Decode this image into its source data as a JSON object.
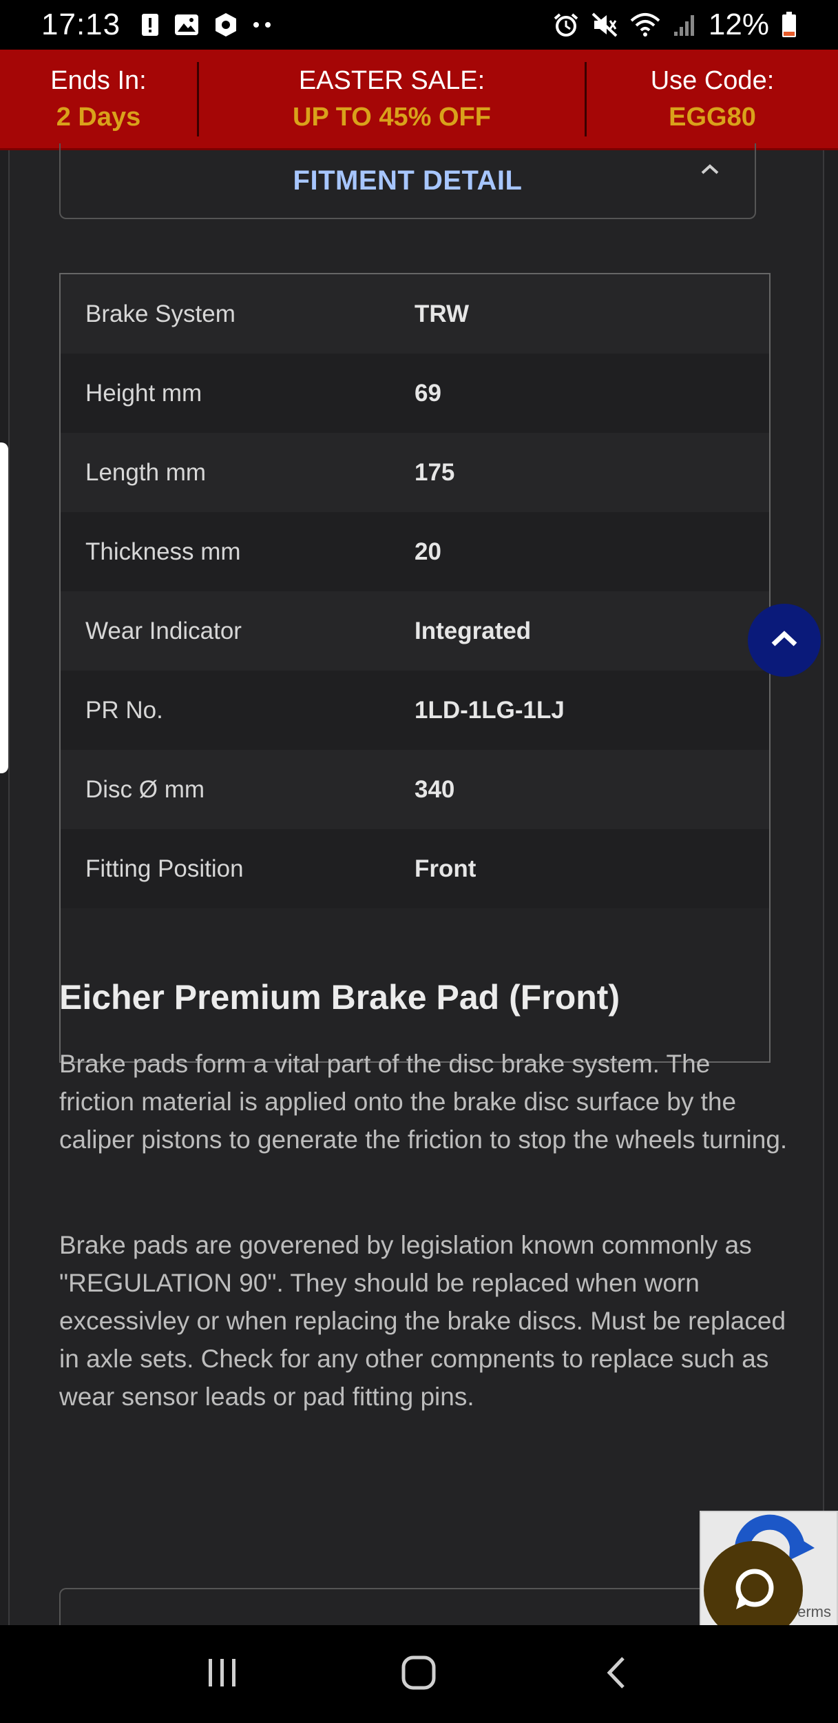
{
  "status_bar": {
    "time": "17:13",
    "battery": "12%",
    "icons": [
      "alert-icon",
      "image-icon",
      "shield-app-icon",
      "more-dots-icon",
      "alarm-icon",
      "mute-icon",
      "wifi-icon",
      "signal-icon",
      "battery-icon"
    ]
  },
  "promo": {
    "ends_label": "Ends In:",
    "ends_value": "2 Days",
    "sale_label": "EASTER SALE:",
    "sale_value": "UP TO 45% OFF",
    "code_label": "Use Code:",
    "code_value": "EGG80",
    "colors": {
      "background": "#a50606",
      "highlight": "#d9a21b"
    }
  },
  "fitment": {
    "title": "FITMENT DETAIL",
    "chevron": "chevron-up-icon"
  },
  "specs": [
    {
      "label": "Brake System",
      "value": "TRW"
    },
    {
      "label": "Height mm",
      "value": "69"
    },
    {
      "label": "Length mm",
      "value": "175"
    },
    {
      "label": "Thickness mm",
      "value": "20"
    },
    {
      "label": "Wear Indicator",
      "value": "Integrated"
    },
    {
      "label": "PR No.",
      "value": "1LD-1LG-1LJ"
    },
    {
      "label": "Disc Ø mm",
      "value": "340"
    },
    {
      "label": "Fitting Position",
      "value": "Front"
    }
  ],
  "description": {
    "title": "Eicher Premium Brake Pad (Front)",
    "para1": "Brake pads form a vital part of the disc brake system. The friction material is applied onto the brake disc surface by the caliper pistons to generate the friction to stop the wheels turning.",
    "para2": "Brake pads are goverened by legislation known commonly as \"REGULATION 90\". They should be replaced when worn excessivley or when replacing the brake discs. Must be replaced in axle sets. Check for any other compnents to replace such as wear sensor leads or pad fitting pins."
  },
  "recaptcha": {
    "terms": "erms"
  },
  "nav": [
    "recent-apps-icon",
    "home-icon",
    "back-icon"
  ]
}
